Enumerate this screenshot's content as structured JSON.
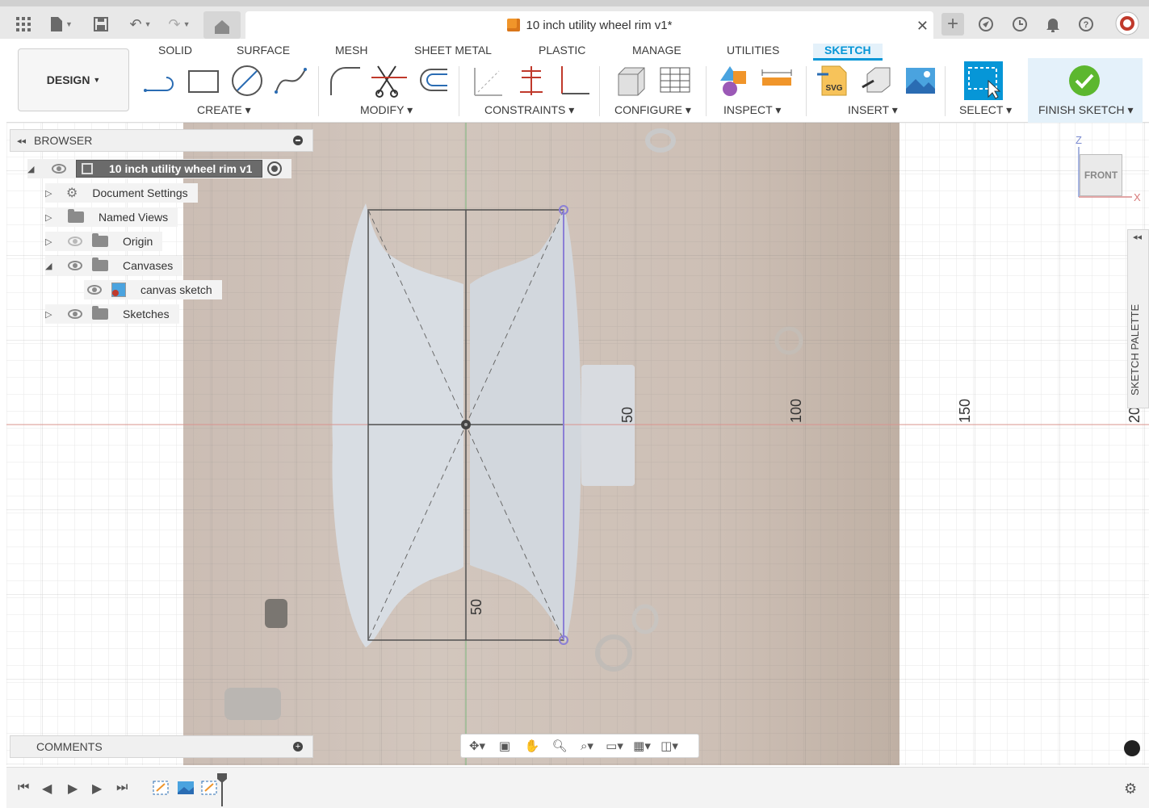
{
  "app": {
    "document_title": "10 inch utility wheel rim v1*"
  },
  "toolbar": {
    "workspace_label": "DESIGN",
    "tabs": [
      "SOLID",
      "SURFACE",
      "MESH",
      "SHEET METAL",
      "PLASTIC",
      "MANAGE",
      "UTILITIES",
      "SKETCH"
    ],
    "active_tab": "SKETCH",
    "groups": {
      "create": "CREATE",
      "modify": "MODIFY",
      "constraints": "CONSTRAINTS",
      "configure": "CONFIGURE",
      "inspect": "INSPECT",
      "insert": "INSERT",
      "select": "SELECT",
      "finish": "FINISH SKETCH"
    }
  },
  "browser": {
    "title": "BROWSER",
    "root": "10 inch utility wheel rim v1",
    "items": [
      {
        "label": "Document Settings"
      },
      {
        "label": "Named Views"
      },
      {
        "label": "Origin"
      },
      {
        "label": "Canvases"
      },
      {
        "label": "canvas sketch"
      },
      {
        "label": "Sketches"
      }
    ]
  },
  "comments": {
    "title": "COMMENTS"
  },
  "viewport": {
    "ruler_labels": [
      "50",
      "100",
      "150",
      "20"
    ],
    "dimension_labels": [
      "50"
    ]
  },
  "viewcube": {
    "face": "FRONT",
    "axis_z": "Z",
    "axis_x": "X"
  },
  "sketch_palette": {
    "label": "SKETCH PALETTE"
  },
  "icons": [
    "grid-menu-icon",
    "file-icon",
    "save-icon",
    "undo-icon",
    "redo-icon",
    "home-icon",
    "close-icon",
    "add-tab-icon",
    "extensions-icon",
    "job-status-icon",
    "notifications-icon",
    "help-icon",
    "avatar-icon"
  ]
}
